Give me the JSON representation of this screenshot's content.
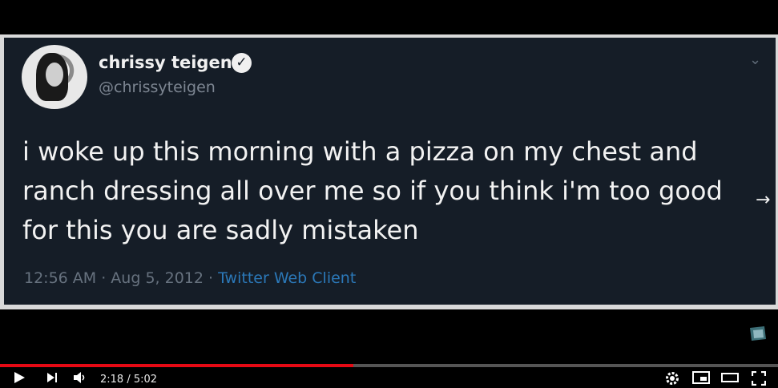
{
  "tweet": {
    "name": "chrissy teigen",
    "handle": "@chrissyteigen",
    "text": "i woke up this morning with a pizza on my chest and ranch dressing all over me so if you think i'm too good for this you are sadly mistaken",
    "timestamp": "12:56 AM · Aug 5, 2012 ·",
    "client": "Twitter Web Client"
  },
  "player": {
    "current_time": "2:18",
    "separator": " / ",
    "duration": "5:02",
    "progress": 0.454,
    "progress_color": "#e50914"
  },
  "icons": [
    "play-icon",
    "next-icon",
    "volume-icon",
    "settings-icon",
    "miniplayer-icon",
    "theater-icon",
    "fullscreen-icon",
    "verified-icon",
    "chevron-down-icon",
    "arrow-right-icon"
  ]
}
